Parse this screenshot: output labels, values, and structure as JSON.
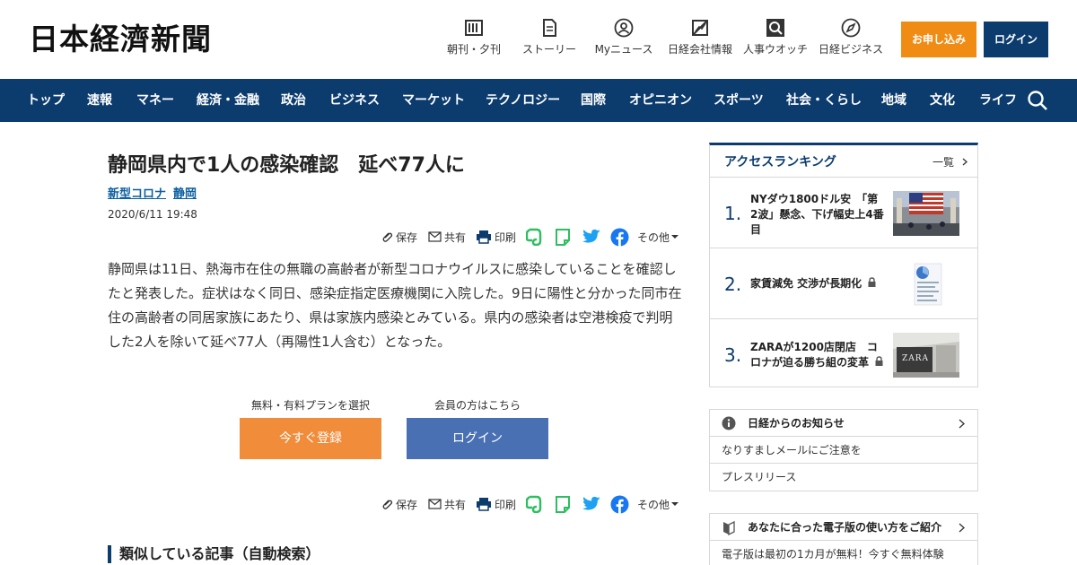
{
  "header": {
    "logo": "日本経濟新聞",
    "nav": [
      {
        "label": "朝刊・夕刊",
        "icon": "newspaper-icon"
      },
      {
        "label": "ストーリー",
        "icon": "document-icon"
      },
      {
        "label": "Myニュース",
        "icon": "user-icon"
      },
      {
        "label": "日経会社情報",
        "icon": "chart-icon"
      },
      {
        "label": "人事ウオッチ",
        "icon": "magnifier-icon"
      },
      {
        "label": "日経ビジネス",
        "icon": "compass-icon"
      }
    ],
    "apply_label": "お申し込み",
    "login_label": "ログイン"
  },
  "navbar": {
    "items": [
      "トップ",
      "速報",
      "マネー",
      "経済・金融",
      "政治",
      "ビジネス",
      "マーケット",
      "テクノロジー",
      "国際",
      "オピニオン",
      "スポーツ",
      "社会・くらし",
      "地域",
      "文化",
      "ライフ"
    ],
    "search_icon": "search-icon"
  },
  "article": {
    "title": "静岡県内で1人の感染確認　延べ77人に",
    "tags": [
      "新型コロナ",
      "静岡"
    ],
    "date": "2020/6/11 19:48",
    "share": {
      "save": "保存",
      "share": "共有",
      "print": "印刷",
      "more": "その他"
    },
    "body": "静岡県は11日、熱海市在住の無職の高齢者が新型コロナウイルスに感染していることを確認したと発表した。症状はなく同日、感染症指定医療機関に入院した。9日に陽性と分かった同市在住の高齢者の同居家族にあたり、県は家族内感染とみている。県内の感染者は空港検疫で判明した2人を除いて延べ77人（再陽性1人含む）となった。",
    "paywall": {
      "plan_label": "無料・有料プランを選択",
      "member_label": "会員の方はこちら",
      "register_button": "今すぐ登録",
      "login_button": "ログイン"
    },
    "similar_heading": "類似している記事（自動検索）"
  },
  "sidebar": {
    "ranking": {
      "title": "アクセスランキング",
      "more": "一覧",
      "items": [
        {
          "rank": "1.",
          "text": "NYダウ1800ドル安　「第2波」懸念、下げ幅史上4番目",
          "locked": false
        },
        {
          "rank": "2.",
          "text": "家賃減免 交渉が長期化",
          "locked": true
        },
        {
          "rank": "3.",
          "text": "ZARAが1200店閉店　コロナが迫る勝ち組の変革",
          "locked": true
        }
      ]
    },
    "notices": {
      "title": "日経からのお知らせ",
      "items": [
        "なりすましメールにご注意を",
        "プレスリリース"
      ]
    },
    "guide": {
      "title": "あなたに合った電子版の使い方をご紹介",
      "items": [
        "電子版は最初の1カ月が無料！今すぐ無料体験"
      ]
    }
  },
  "colors": {
    "navy": "#0c3c6e",
    "orange": "#f08c14",
    "login_blue": "#4a70b4",
    "evernote": "#2dbe60",
    "twitter": "#1da1f2",
    "facebook": "#1877f2"
  }
}
